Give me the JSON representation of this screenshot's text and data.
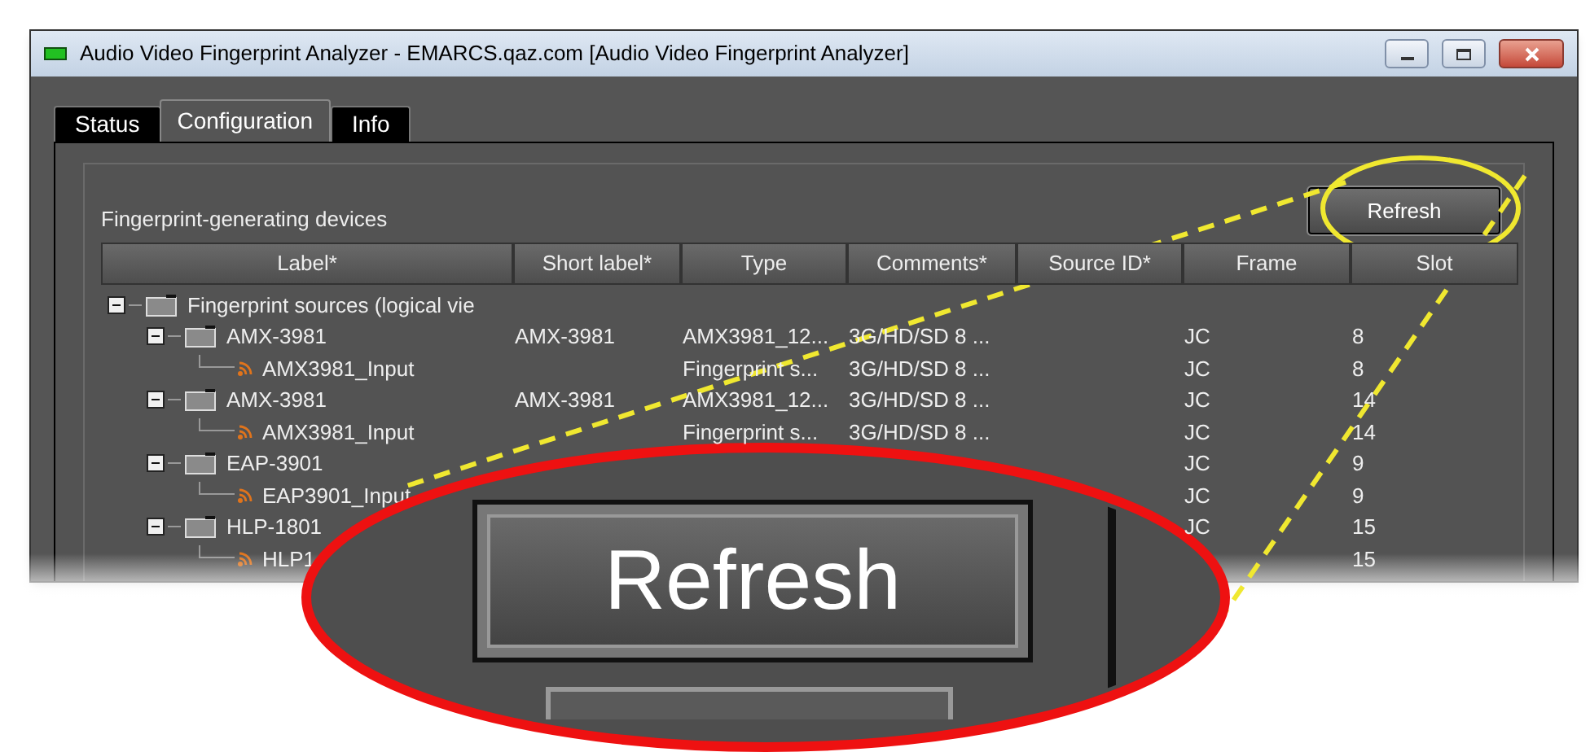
{
  "window": {
    "title": "Audio Video Fingerprint Analyzer - EMARCS.qaz.com [Audio Video Fingerprint Analyzer]"
  },
  "tabs": [
    {
      "label": "Status",
      "selected": false
    },
    {
      "label": "Configuration",
      "selected": true
    },
    {
      "label": "Info",
      "selected": false
    }
  ],
  "group": {
    "title": "Fingerprint-generating devices",
    "refresh_button": "Refresh"
  },
  "table": {
    "columns": [
      "Label*",
      "Short label*",
      "Type",
      "Comments*",
      "Source ID*",
      "Frame",
      "Slot"
    ],
    "rows": [
      {
        "kind": "folder",
        "label": "Fingerprint sources (logical vie",
        "expanded": true,
        "children": [
          {
            "kind": "folder",
            "label": "AMX-3981",
            "cells": [
              "AMX-3981",
              "AMX3981_12...",
              "3G/HD/SD 8 ...",
              "",
              "JC",
              "8"
            ],
            "expanded": true,
            "children": [
              {
                "kind": "input",
                "label": "AMX3981_Input",
                "cells": [
                  "",
                  "Fingerprint s...",
                  "3G/HD/SD 8 ...",
                  "",
                  "JC",
                  "8"
                ]
              }
            ]
          },
          {
            "kind": "folder",
            "label": "AMX-3981",
            "cells": [
              "AMX-3981",
              "AMX3981_12...",
              "3G/HD/SD 8 ...",
              "",
              "JC",
              "14"
            ],
            "expanded": true,
            "children": [
              {
                "kind": "input",
                "label": "AMX3981_Input",
                "cells": [
                  "",
                  "Fingerprint s...",
                  "3G/HD/SD 8 ...",
                  "",
                  "JC",
                  "14"
                ]
              }
            ]
          },
          {
            "kind": "folder",
            "label": "EAP-3901",
            "cells": [
              "",
              "",
              "",
              "",
              "JC",
              "9"
            ],
            "expanded": true,
            "children": [
              {
                "kind": "input",
                "label": "EAP3901_Input",
                "cells": [
                  "",
                  "",
                  "",
                  "",
                  "JC",
                  "9"
                ]
              }
            ]
          },
          {
            "kind": "folder",
            "label": "HLP-1801",
            "cells": [
              "",
              "",
              "",
              "",
              "JC",
              "15"
            ],
            "expanded": true,
            "children": [
              {
                "kind": "input",
                "label": "HLP1",
                "cells": [
                  "",
                  "",
                  "",
                  "",
                  "",
                  "15"
                ]
              }
            ]
          }
        ]
      }
    ]
  },
  "callout": {
    "label": "Refresh"
  }
}
